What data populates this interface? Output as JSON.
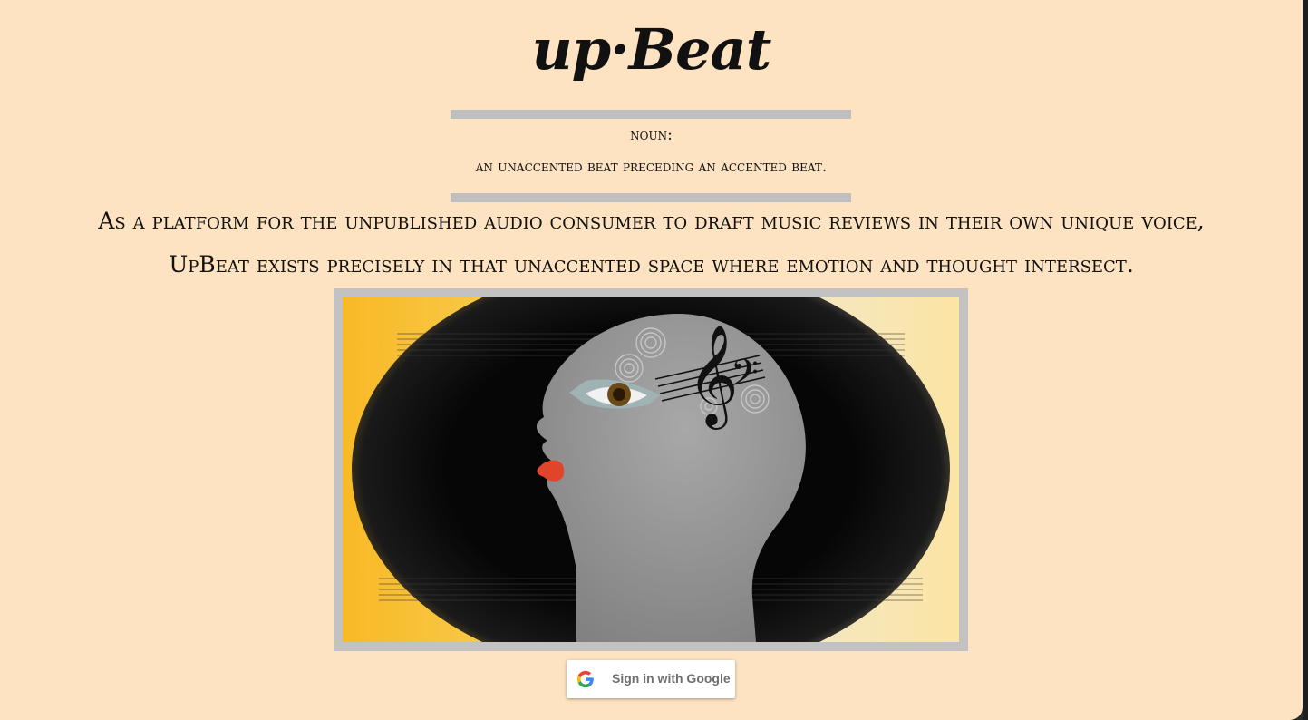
{
  "header": {
    "title": "up·Beat"
  },
  "definition": {
    "part_of_speech": "noun:",
    "meaning": "an unaccented beat preceding an accented beat."
  },
  "tagline": {
    "line1": "As a platform for the unpublished audio consumer to draft music reviews in their own unique voice,",
    "line2": "UpBeat exists precisely in that unaccented space where emotion and thought intersect."
  },
  "hero_image": {
    "icon": "head-with-music-clef-illustration"
  },
  "auth": {
    "signin_label": "Sign in with Google",
    "icon": "google-g-icon"
  },
  "colors": {
    "background": "#fde3c1",
    "rule": "#bfbfbf",
    "frame": "#c2c2c2",
    "accent_yellow": "#f9b926"
  }
}
